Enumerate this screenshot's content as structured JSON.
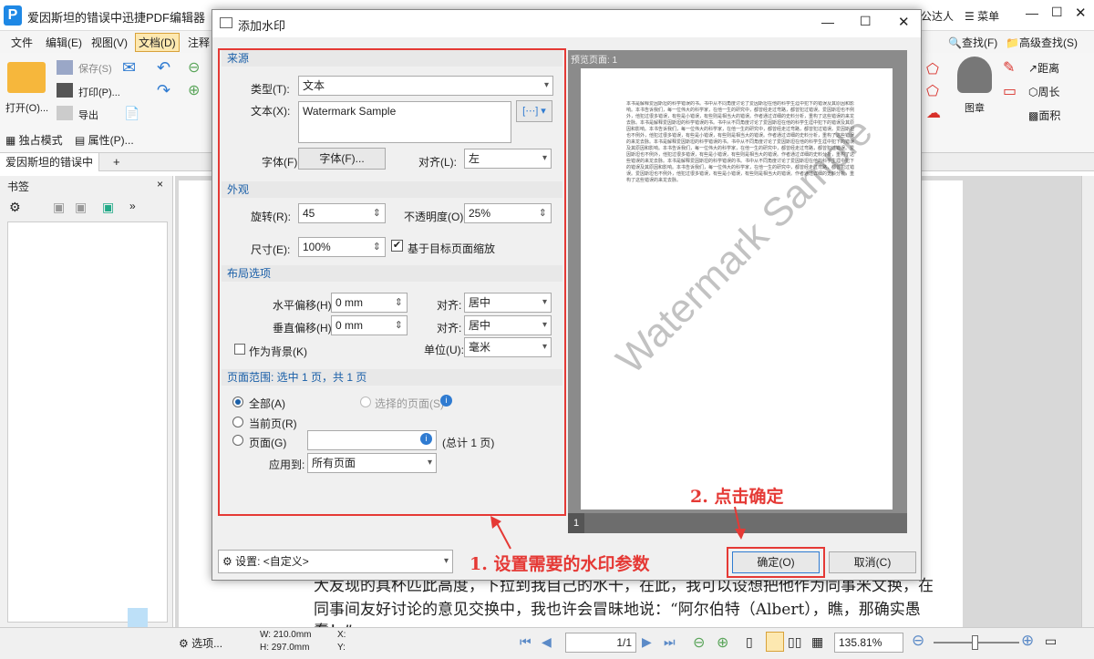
{
  "app": {
    "title": "爱因斯坦的错误中迅捷PDF编辑器",
    "user": "公达人",
    "menu_btn": "菜单"
  },
  "menu": [
    "文件",
    "编辑(E)",
    "视图(V)",
    "文档(D)",
    "注释"
  ],
  "ribbon": {
    "open": "打开(O)...",
    "save": "保存(S)",
    "print": "打印(P)...",
    "export": "导出",
    "exclusive": "独占模式",
    "properties": "属性(P)...",
    "find": "查找(F)",
    "adv_find": "高级查找(S)",
    "stamp": "图章",
    "distance": "距离",
    "perimeter": "周长",
    "area": "面积"
  },
  "doc_tab": "爱因斯坦的错误中",
  "left_panel": {
    "title": "书签"
  },
  "dialog": {
    "title": "添加水印",
    "source": {
      "header": "来源",
      "type_label": "类型(T):",
      "type_value": "文本",
      "text_label": "文本(X):",
      "text_value": "Watermark Sample",
      "font_label": "字体(F):",
      "font_btn": "字体(F)...",
      "align_label": "对齐(L):",
      "align_value": "左"
    },
    "appearance": {
      "header": "外观",
      "rotation_label": "旋转(R):",
      "rotation_value": "45",
      "opacity_label": "不透明度(O):",
      "opacity_value": "25%",
      "size_label": "尺寸(E):",
      "size_value": "100%",
      "scale_label": "基于目标页面缩放"
    },
    "layout": {
      "header": "布局选项",
      "h_offset_label": "水平偏移(H):",
      "h_offset_value": "0 mm",
      "v_offset_label": "垂直偏移(H):",
      "v_offset_value": "0 mm",
      "align1_label": "对齐:",
      "align1_value": "居中",
      "align2_label": "对齐:",
      "align2_value": "居中",
      "unit_label": "单位(U):",
      "unit_value": "毫米",
      "as_bg_label": "作为背景(K)"
    },
    "range": {
      "header": "页面范围: 选中 1 页，共 1 页",
      "all": "全部(A)",
      "selected": "选择的页面(S)",
      "current": "当前页(R)",
      "pages": "页面(G)",
      "total": "(总计 1 页)",
      "apply_label": "应用到:",
      "apply_value": "所有页面"
    },
    "preview": {
      "label": "预览页面: 1",
      "page_num": "1",
      "watermark": "Watermark Sample"
    },
    "settings": "设置: <自定义>",
    "ok": "确定(O)",
    "cancel": "取消(C)"
  },
  "annotations": {
    "step1": "1. 设置需要的水印参数",
    "step2": "2. 点击确定"
  },
  "body_text": {
    "line1": "大友现的具杯匹此高度，下拉到我自己的水干，在此，我可以设想把他作为同事米文换，在",
    "line2": "同事间友好讨论的意见交换中，我也许会冒昧地说：“阿尔伯特（Albert），瞧，那确实愚",
    "line3": "蠢！”"
  },
  "statusbar": {
    "options": "选项...",
    "w": "W: 210.0mm",
    "h": "H: 297.0mm",
    "x": "X:",
    "y": "Y:",
    "page": "1/1",
    "zoom": "135.81%"
  }
}
